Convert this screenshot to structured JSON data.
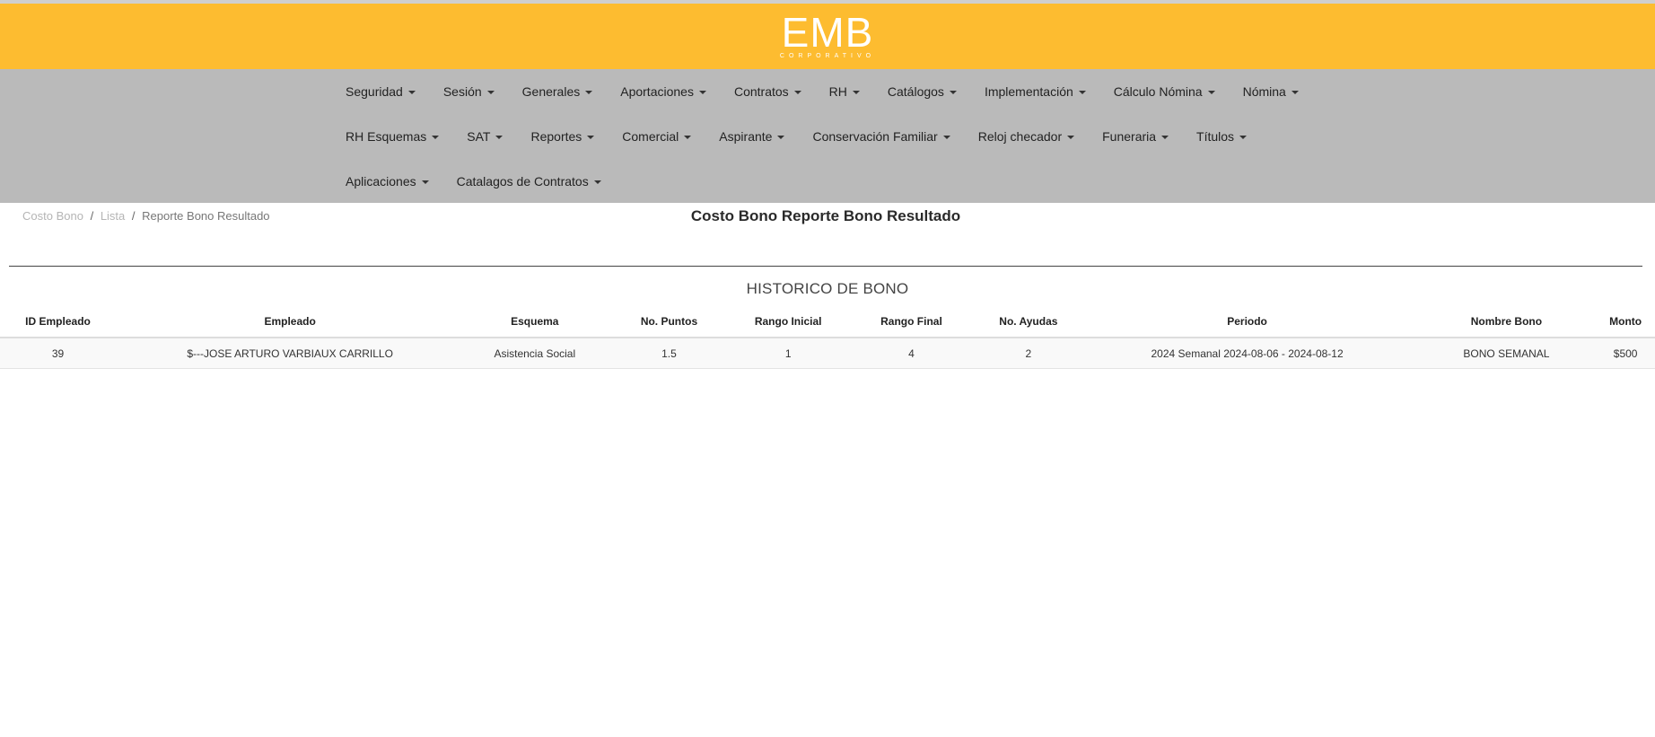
{
  "header": {
    "logo_text": "EMB",
    "logo_subtext": "CORPORATIVO",
    "brand_color": "#fdbc30",
    "nav_color": "#bababa"
  },
  "nav": {
    "rows": [
      [
        "Seguridad",
        "Sesión",
        "Generales",
        "Aportaciones",
        "Contratos",
        "RH",
        "Catálogos",
        "Implementación",
        "Cálculo Nómina",
        "Nómina"
      ],
      [
        "RH Esquemas",
        "SAT",
        "Reportes",
        "Comercial",
        "Aspirante",
        "Conservación Familiar",
        "Reloj checador",
        "Funeraria",
        "Títulos"
      ],
      [
        "Aplicaciones",
        "Catalagos de Contratos"
      ]
    ]
  },
  "breadcrumb": {
    "item1": "Costo Bono",
    "item2": "Lista",
    "current": "Reporte Bono Resultado",
    "separator": "/"
  },
  "page_title": "Costo Bono Reporte Bono Resultado",
  "section_title": "HISTORICO DE BONO",
  "table": {
    "columns": [
      "ID Empleado",
      "Empleado",
      "Esquema",
      "No. Puntos",
      "Rango Inicial",
      "Rango Final",
      "No. Ayudas",
      "Periodo",
      "Nombre Bono",
      "Monto"
    ],
    "rows": [
      [
        "39",
        "$---JOSE ARTURO VARBIAUX CARRILLO",
        "Asistencia Social",
        "1.5",
        "1",
        "4",
        "2",
        "2024 Semanal 2024-08-06 - 2024-08-12",
        "BONO SEMANAL",
        "$500"
      ]
    ]
  }
}
